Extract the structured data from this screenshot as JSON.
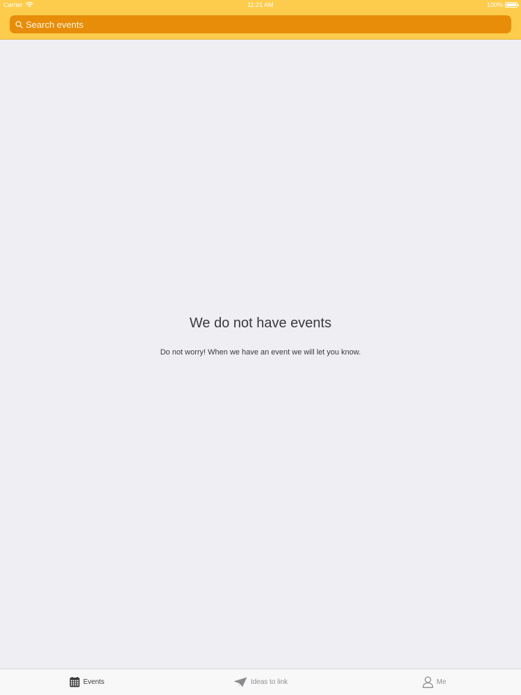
{
  "status_bar": {
    "carrier": "Carrier",
    "time": "11:21 AM",
    "battery": "100%",
    "wifi_icon": "wifi-icon",
    "battery_icon": "battery-icon"
  },
  "search": {
    "placeholder": "Search events",
    "value": "",
    "icon": "search-icon"
  },
  "empty_state": {
    "title": "We do not have events",
    "subtitle": "Do not worry! When we have an event we will let you know."
  },
  "tabs": [
    {
      "label": "Events",
      "icon": "calendar-icon",
      "active": true
    },
    {
      "label": "Ideas to link",
      "icon": "paper-plane-icon",
      "active": false
    },
    {
      "label": "Me",
      "icon": "person-icon",
      "active": false
    }
  ],
  "colors": {
    "header": "#fdcc4c",
    "search_bar": "#e88d09",
    "background": "#efeef3",
    "tab_active": "#3a3a3c",
    "tab_inactive": "#8e8e93"
  }
}
